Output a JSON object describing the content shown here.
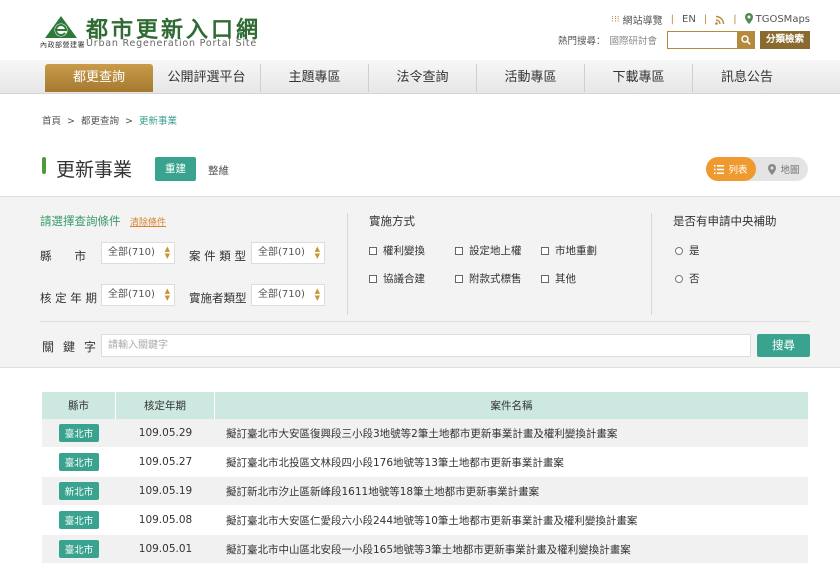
{
  "header": {
    "site_title": "都市更新入口網",
    "site_title_en": "Urban Regeneration Portal Site",
    "ministry_label": "內政部營建署",
    "top_links": [
      {
        "label": "網站導覽"
      },
      {
        "label": "EN"
      },
      {
        "label": "TGOSMaps"
      }
    ],
    "hot_search_label": "熱門搜尋：",
    "hot_search_term": "國際研討會",
    "search_value": "",
    "advanced_search_label": "分類檢索"
  },
  "nav": {
    "items": [
      {
        "label": "都更查詢",
        "active": true
      },
      {
        "label": "公開評選平台"
      },
      {
        "label": "主題專區"
      },
      {
        "label": "法令查詢"
      },
      {
        "label": "活動專區"
      },
      {
        "label": "下載專區"
      },
      {
        "label": "訊息公告"
      }
    ]
  },
  "breadcrumb": [
    "首頁",
    "都更查詢",
    "更新事業"
  ],
  "page": {
    "title": "更新事業",
    "tab_redevelop": "重建",
    "tab_renovate": "整維",
    "view_list": "列表",
    "view_map": "地圖"
  },
  "filter": {
    "heading": "請選擇查詢條件",
    "clear_label": "清除條件",
    "county_label": "縣　　市",
    "county_value": "全部(710)",
    "case_type_label": "案 件 類 型",
    "case_type_value": "全部(710)",
    "year_label": "核 定 年 期",
    "year_value": "全部(710)",
    "implementer_label": "實施者類型",
    "implementer_value": "全部(710)",
    "method_heading": "實施方式",
    "methods": [
      "權利變換",
      "設定地上權",
      "市地重劃",
      "協議合建",
      "附款式標售",
      "其他"
    ],
    "subsidy_heading": "是否有申請中央補助",
    "subsidy_options": [
      "是",
      "否"
    ],
    "keyword_label": "關鍵字",
    "keyword_placeholder": "請輸入關鍵字",
    "search_button": "搜尋"
  },
  "table": {
    "headers": [
      "縣市",
      "核定年期",
      "案件名稱"
    ],
    "rows": [
      {
        "city": "臺北市",
        "date": "109.05.29",
        "name": "擬訂臺北市大安區復興段三小段3地號等2筆土地都市更新事業計畫及權利變換計畫案"
      },
      {
        "city": "臺北市",
        "date": "109.05.27",
        "name": "擬訂臺北市北投區文林段四小段176地號等13筆土地都市更新事業計畫案"
      },
      {
        "city": "新北市",
        "date": "109.05.19",
        "name": "擬訂新北市汐止區新峰段1611地號等18筆土地都市更新事業計畫案"
      },
      {
        "city": "臺北市",
        "date": "109.05.08",
        "name": "擬訂臺北市大安區仁愛段六小段244地號等10筆土地都市更新事業計畫及權利變換計畫案"
      },
      {
        "city": "臺北市",
        "date": "109.05.01",
        "name": "擬訂臺北市中山區北安段一小段165地號等3筆土地都市更新事業計畫及權利變換計畫案"
      }
    ]
  },
  "colors": {
    "accent_green": "#3aa38f",
    "gold": "#b68a3c",
    "orange": "#ef9a2e"
  }
}
